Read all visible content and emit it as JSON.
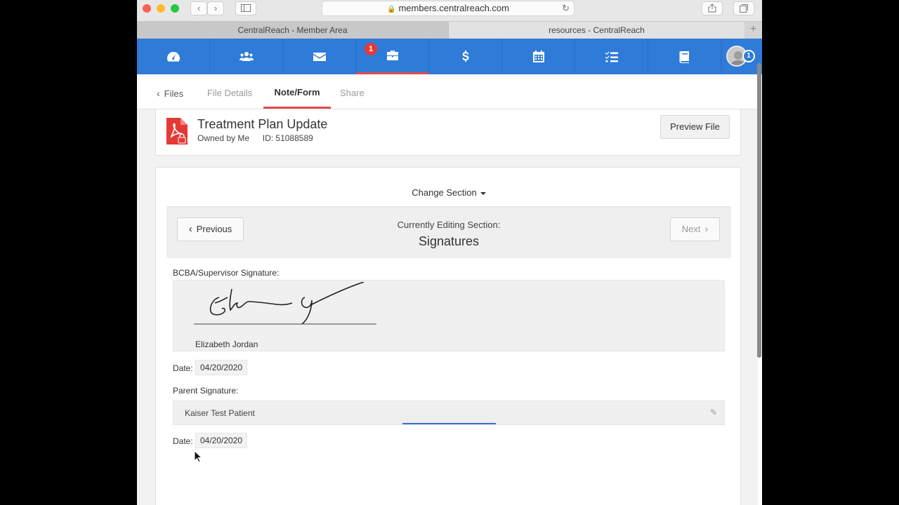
{
  "browser": {
    "url": "members.centralreach.com",
    "tabs": [
      {
        "label": "CentralReach - Member Area"
      },
      {
        "label": "resources - CentralReach"
      }
    ],
    "new_tab": "+"
  },
  "app_nav": {
    "items": [
      {
        "icon": "dashboard-icon"
      },
      {
        "icon": "contacts-icon"
      },
      {
        "icon": "mail-icon"
      },
      {
        "icon": "briefcase-icon",
        "badge": "1",
        "active": true
      },
      {
        "icon": "billing-dollar-icon"
      },
      {
        "icon": "calendar-icon"
      },
      {
        "icon": "task-list-icon"
      },
      {
        "icon": "book-icon"
      }
    ],
    "avatar_badge": "1",
    "accent_color": "#2f7bd8"
  },
  "sub_tabs": {
    "back": "Files",
    "items": [
      "File Details",
      "Note/Form",
      "Share"
    ],
    "active": "Note/Form"
  },
  "file": {
    "title": "Treatment Plan Update",
    "owner": "Owned by Me",
    "id_label": "ID: 51088589",
    "preview_button": "Preview File"
  },
  "form": {
    "change_section": "Change Section",
    "editing_label": "Currently Editing Section:",
    "section_name": "Signatures",
    "previous": "Previous",
    "next": "Next",
    "bcba_label": "BCBA/Supervisor Signature:",
    "bcba_name": "Elizabeth Jordan",
    "date_label": "Date:",
    "bcba_date": "04/20/2020",
    "parent_label": "Parent Signature:",
    "parent_name": "Kaiser Test Patient",
    "parent_date": "04/20/2020"
  }
}
